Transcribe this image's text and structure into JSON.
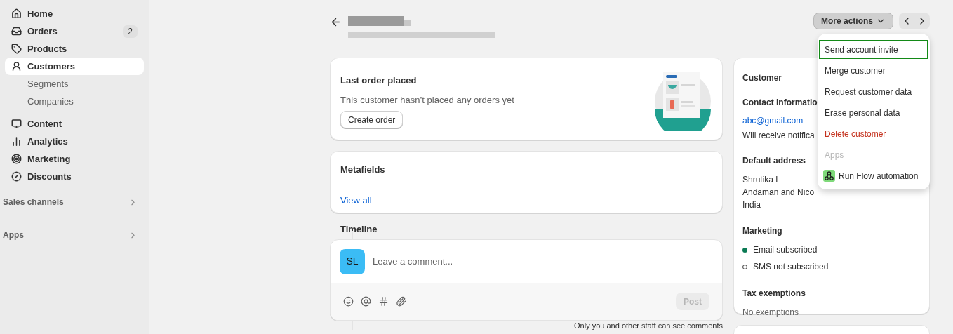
{
  "sidebar": {
    "items": [
      {
        "label": "Home",
        "selected": false
      },
      {
        "label": "Orders",
        "badge": "2",
        "selected": false
      },
      {
        "label": "Products",
        "selected": false
      },
      {
        "label": "Customers",
        "selected": true,
        "children": [
          {
            "label": "Segments",
            "selected": false
          },
          {
            "label": "Companies",
            "selected": false
          }
        ]
      },
      {
        "label": "Content",
        "selected": false
      },
      {
        "label": "Analytics",
        "selected": false
      },
      {
        "label": "Marketing",
        "selected": false
      },
      {
        "label": "Discounts",
        "selected": false
      }
    ],
    "sections": [
      {
        "label": "Sales channels"
      },
      {
        "label": "Apps"
      }
    ]
  },
  "header": {
    "more_actions": "More actions"
  },
  "menu": {
    "items": [
      {
        "kind": "action",
        "label": "Send account invite",
        "highlighted": true
      },
      {
        "kind": "action",
        "label": "Merge customer",
        "highlighted": false
      },
      {
        "kind": "action",
        "label": "Request customer data",
        "highlighted": false
      },
      {
        "kind": "action",
        "label": "Erase personal data",
        "highlighted": false
      },
      {
        "kind": "destructive",
        "label": "Delete customer",
        "highlighted": false
      },
      {
        "kind": "section",
        "label": "Apps",
        "highlighted": false
      },
      {
        "kind": "app",
        "label": "Run Flow automation",
        "highlighted": false
      }
    ]
  },
  "last_order": {
    "title": "Last order placed",
    "text": "This customer hasn’t placed any orders yet",
    "button": "Create order"
  },
  "metafields": {
    "title": "Metafields",
    "link": "View all"
  },
  "timeline": {
    "title": "Timeline",
    "avatar": "SL",
    "placeholder": "Leave a comment...",
    "post": "Post",
    "post_disabled": true,
    "note": "Only you and other staff can see comments"
  },
  "customer": {
    "title": "Customer",
    "contact_heading": "Contact informatio",
    "email": "abc@gmail.com",
    "notification": "Will receive notifica",
    "address_heading": "Default address",
    "address_lines": [
      "Shrutika L",
      "Andaman and Nico",
      "India"
    ],
    "marketing_heading": "Marketing",
    "marketing": [
      {
        "label": "Email subscribed",
        "subscribed": true
      },
      {
        "label": "SMS not subscribed",
        "subscribed": false
      }
    ],
    "tax_heading": "Tax exemptions",
    "tax": "No exemptions"
  }
}
